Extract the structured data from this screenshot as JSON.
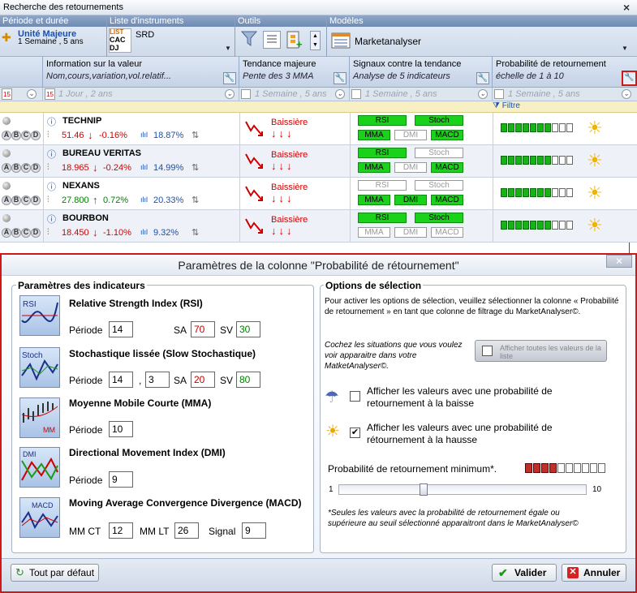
{
  "window": {
    "title": "Recherche des retournements"
  },
  "toolbar": {
    "groups": [
      "Période et durée",
      "Liste d'instruments",
      "Outils",
      "Modèles"
    ],
    "period": {
      "line1": "Unité Majeure",
      "line2": "1 Semaine , 5 ans"
    },
    "list": {
      "badges": [
        "LIST",
        "CAC",
        "DJ"
      ],
      "label": "SRD"
    },
    "model": {
      "label": "Marketanalyser"
    }
  },
  "columns": [
    {
      "title": "Information sur la valeur",
      "sub": "Nom,cours,variation,vol.relatif..."
    },
    {
      "title": "Tendance majeure",
      "sub": "Pente des 3 MMA"
    },
    {
      "title": "Signaux contre la tendance",
      "sub": "Analyse de 5 indicateurs"
    },
    {
      "title": "Probabilité de retournement",
      "sub": "échelle de 1 à 10"
    }
  ],
  "filters": {
    "col1": "1 Jour , 2 ans",
    "col2": "1 Semaine , 5 ans",
    "col3": "1 Semaine , 5 ans",
    "col4": "1 Semaine , 5 ans",
    "cal": "15",
    "filtre": "Filtre"
  },
  "rows": [
    {
      "name": "TECHNIP",
      "price": "51.46",
      "arrow": "↓",
      "change": "-0.16%",
      "vol": "18.87%",
      "up": false,
      "trend": "Baissière",
      "sigs": {
        "RSI": true,
        "Stoch": true,
        "MMA": true,
        "DMI": false,
        "MACD": true
      },
      "prob": 7
    },
    {
      "name": "BUREAU VERITAS",
      "price": "18.965",
      "arrow": "↓",
      "change": "-0.24%",
      "vol": "14.99%",
      "up": false,
      "trend": "Baissière",
      "sigs": {
        "RSI": true,
        "Stoch": false,
        "MMA": true,
        "DMI": false,
        "MACD": true
      },
      "prob": 7
    },
    {
      "name": "NEXANS",
      "price": "27.800",
      "arrow": "↑",
      "change": "0.72%",
      "vol": "20.33%",
      "up": true,
      "trend": "Baissière",
      "sigs": {
        "RSI": false,
        "Stoch": false,
        "MMA": true,
        "DMI": true,
        "MACD": true
      },
      "prob": 7
    },
    {
      "name": "BOURBON",
      "price": "18.450",
      "arrow": "↓",
      "change": "-1.10%",
      "vol": "9.32%",
      "up": false,
      "trend": "Baissière",
      "sigs": {
        "RSI": true,
        "Stoch": true,
        "MMA": false,
        "DMI": false,
        "MACD": false
      },
      "prob": 7
    }
  ],
  "letters": [
    "A",
    "B",
    "C",
    "D"
  ],
  "dialog": {
    "title": "Paramètres de la colonne  \"Probabilité de rétournement\"",
    "left_title": "Paramètres des indicateurs",
    "rsi": {
      "name": "Relative Strength Index (RSI)",
      "thumb": "RSI",
      "periode_label": "Période",
      "periode": "14",
      "sa_label": "SA",
      "sa": "70",
      "sv_label": "SV",
      "sv": "30"
    },
    "stoch": {
      "name": "Stochastique lissée (Slow Stochastique)",
      "thumb": "Stoch",
      "periode_label": "Période",
      "p1": "14",
      "comma": ",",
      "p2": "3",
      "sa_label": "SA",
      "sa": "20",
      "sv_label": "SV",
      "sv": "80"
    },
    "mma": {
      "name": "Moyenne Mobile Courte (MMA)",
      "thumb": "MM",
      "periode_label": "Période",
      "periode": "10"
    },
    "dmi": {
      "name": "Directional Movement Index (DMI)",
      "thumb": "DMI",
      "periode_label": "Période",
      "periode": "9"
    },
    "macd": {
      "name": "Moving Average Convergence Divergence (MACD)",
      "thumb": "MACD",
      "ct_label": "MM CT",
      "ct": "12",
      "lt_label": "MM LT",
      "lt": "26",
      "signal_label": "Signal",
      "signal": "9"
    },
    "right_title": "Options de sélection",
    "info": "Pour activer les options de sélection, veuillez sélectionner la colonne « Probabilité de retournement » en tant que colonne de filtrage du MarketAnalyser©.",
    "cochez": "Cochez les situations que vous voulez voir apparaitre dans votre MatketAnalyser©.",
    "show_all": "Afficher toutes les valeurs de la liste",
    "opt_baisse": "Afficher les valeurs avec une probabilité de retournement à la baisse",
    "opt_hausse": "Afficher les valeurs avec  une probabilité de rétournement à la hausse",
    "opt_baisse_checked": false,
    "opt_hausse_checked": true,
    "minprob_label": "Probabilité de retournement minimum*.",
    "minprob": 4,
    "slider_min": "1",
    "slider_max": "10",
    "footnote": "*Seules les valeurs avec la probabilité de retournement égale ou supérieure au seuil sélectionné apparaitront dans le MarketAnalyser©",
    "defaults_btn": "Tout par défaut",
    "ok_btn": "Valider",
    "cancel_btn": "Annuler"
  }
}
